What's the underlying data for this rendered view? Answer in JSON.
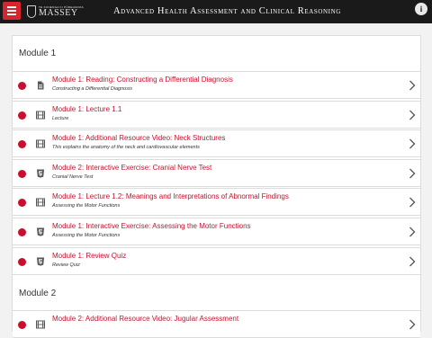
{
  "header": {
    "logo_small": "TE KUNENGA KI PŪREHUROA",
    "logo_big": "MASSEY",
    "title": "Advanced Health Assessment and Clinical Reasoning",
    "info_label": "i"
  },
  "sections": [
    {
      "title": "Module 1",
      "items": [
        {
          "title": "Module 1: Reading: Constructing a Differential Diagnosis",
          "subtitle": "Constructing a Differential Diagnosis",
          "icon": "document-icon"
        },
        {
          "title": "Module 1: Lecture 1.1",
          "subtitle": "Lecture",
          "icon": "film-icon"
        },
        {
          "title": "Module 1: Additional Resource Video: Neck Structures",
          "subtitle": "This explains the anatomy of the neck and cardiovascular elements",
          "icon": "film-icon"
        },
        {
          "title": "Module 2: Interactive Exercise: Cranial Nerve Test",
          "subtitle": "Cranial Nerve Test",
          "icon": "html5-icon"
        },
        {
          "title": "Module 1: Lecture 1.2: Meanings and Interpretations of Abnormal Findings",
          "subtitle": "Assessing the Motor Functions",
          "icon": "film-icon"
        },
        {
          "title": "Module 1: Interactive Exercise: Assessing the Motor Functions",
          "subtitle": "Assessing the Motor Functions",
          "icon": "html5-icon"
        },
        {
          "title": "Module 1: Review Quiz",
          "subtitle": "Review Quiz",
          "icon": "html5-icon"
        }
      ]
    },
    {
      "title": "Module 2",
      "items": [
        {
          "title": "Module 2: Additional Resource Video: Jugular Assessment",
          "subtitle": "",
          "icon": "film-icon"
        }
      ]
    }
  ],
  "colors": {
    "accent": "#c8102e",
    "topbar": "#1a1a1a",
    "menu_button": "#d6252d"
  }
}
